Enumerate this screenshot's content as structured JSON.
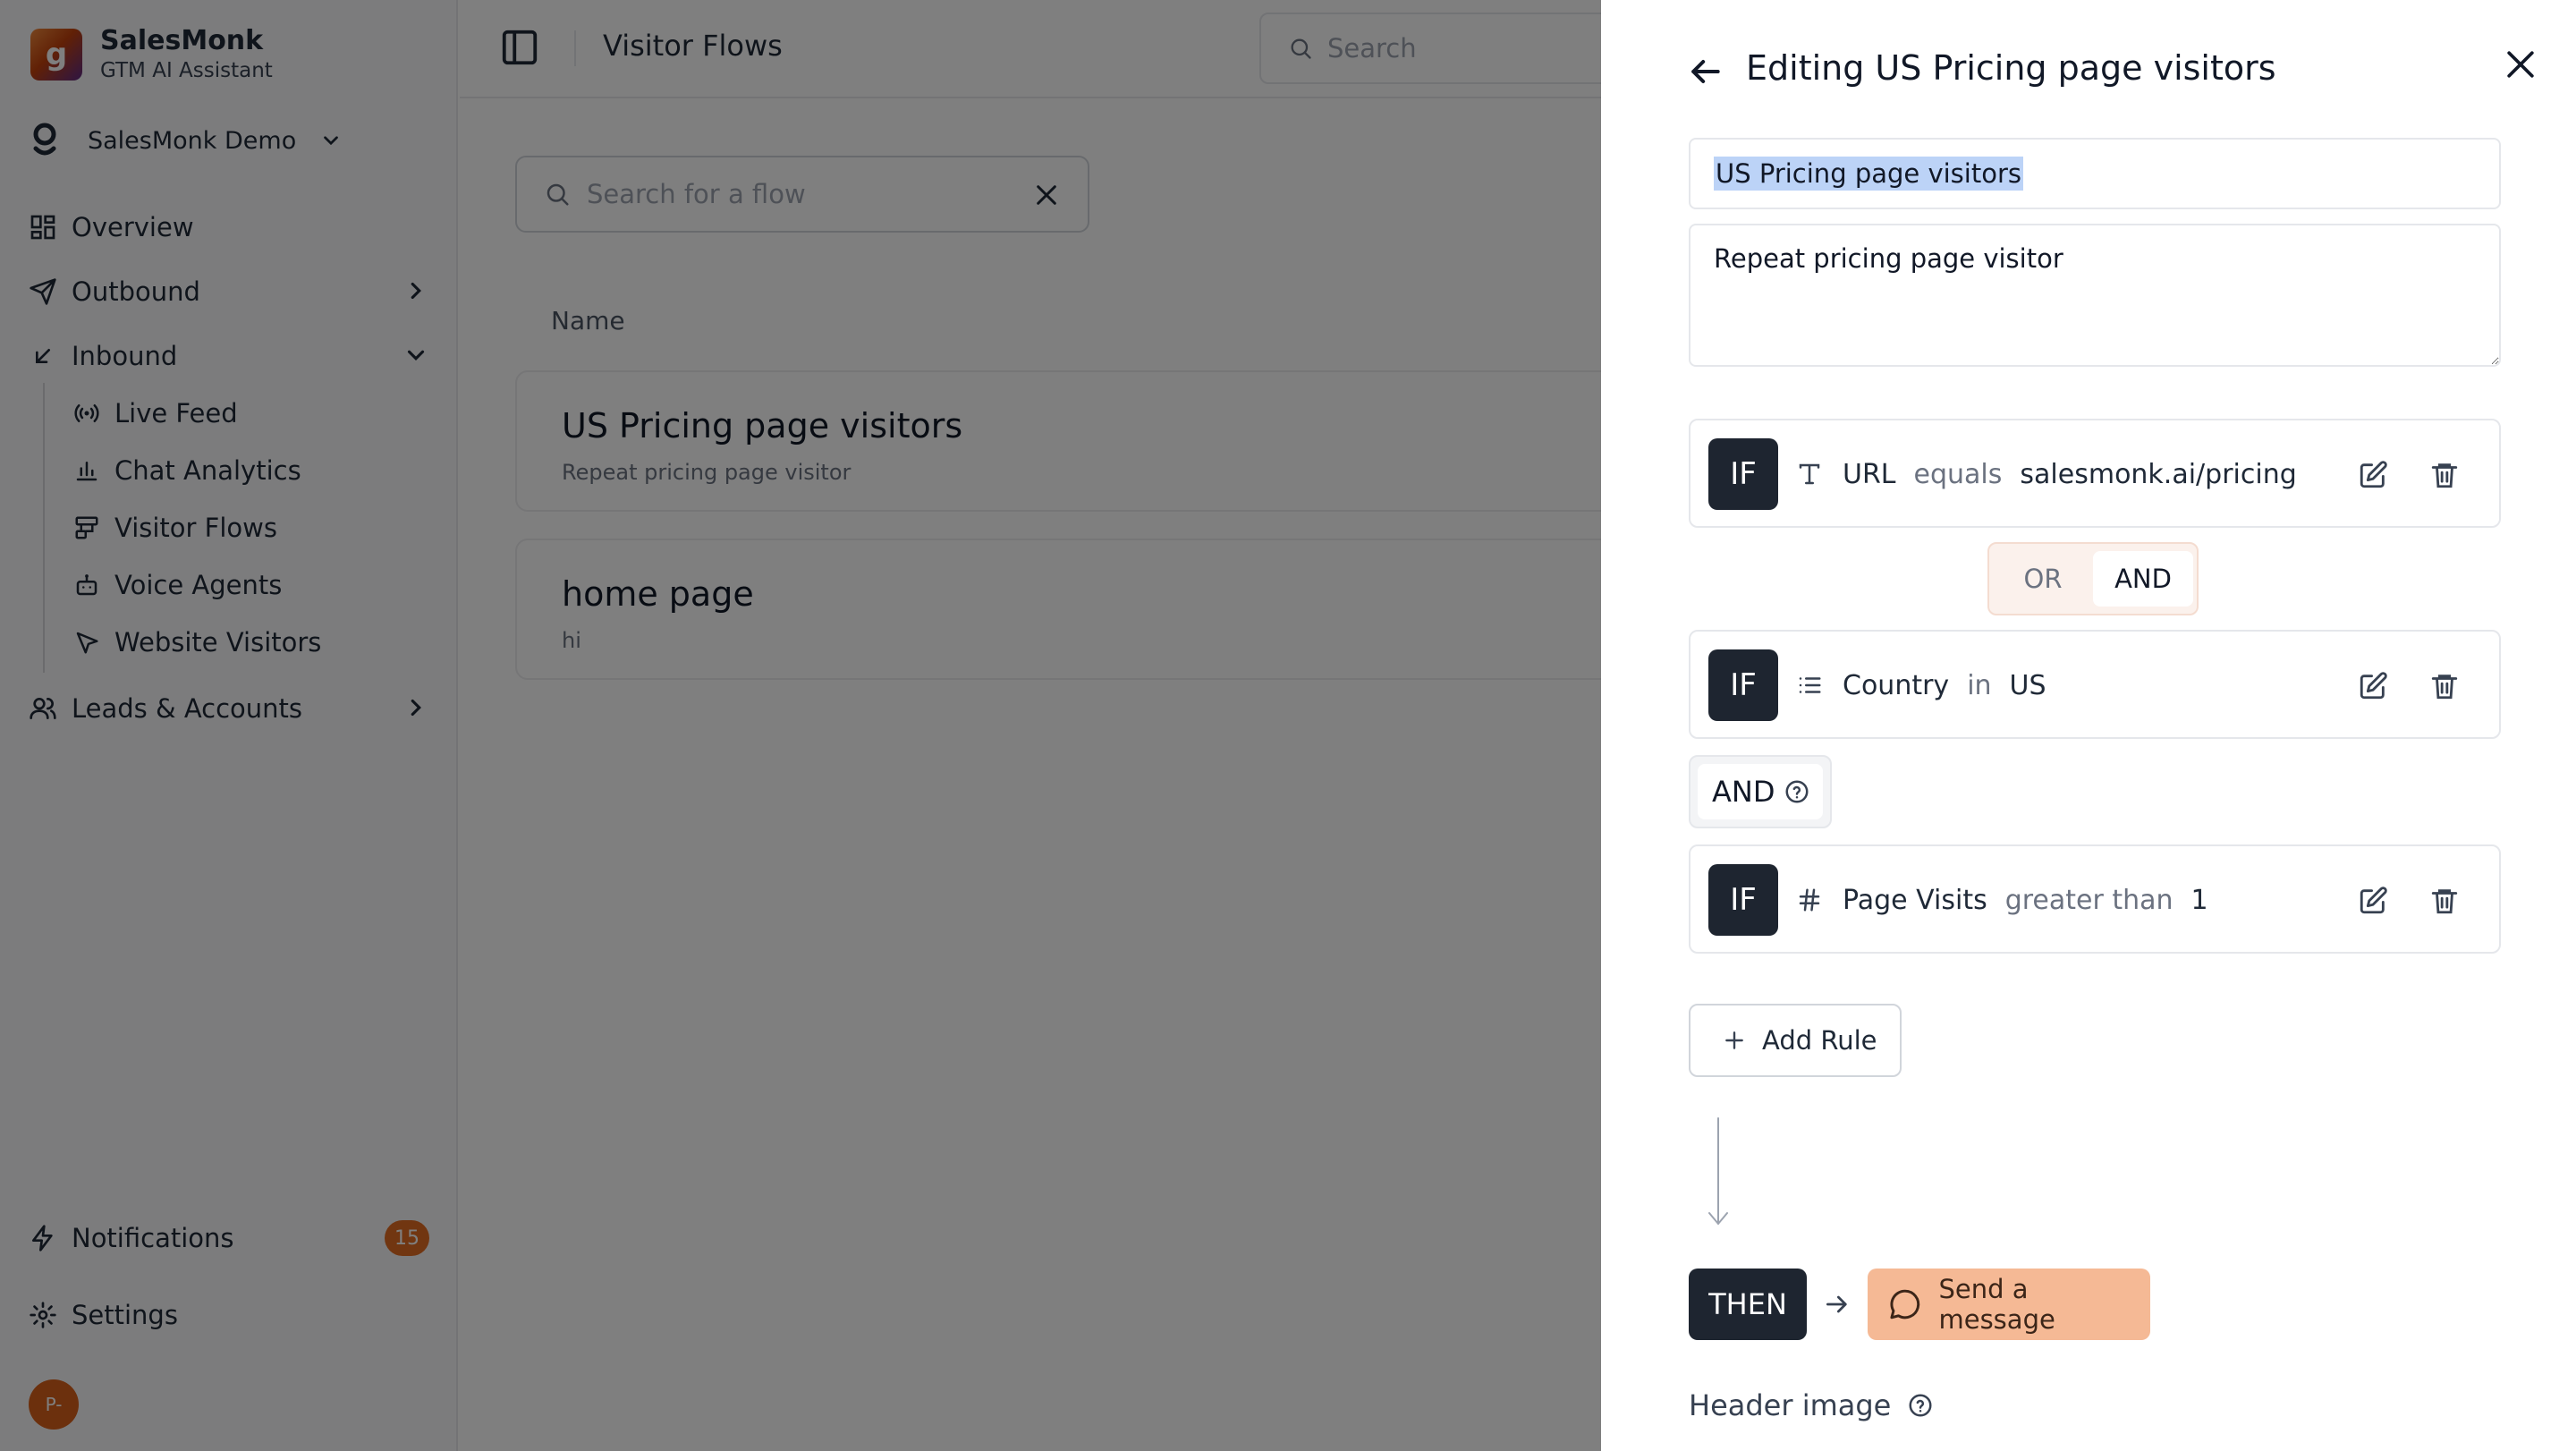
{
  "app": {
    "brand_name": "SalesMonk",
    "brand_subtitle": "GTM AI Assistant",
    "workspace": "SalesMonk Demo"
  },
  "sidebar": {
    "overview": "Overview",
    "outbound": "Outbound",
    "inbound": "Inbound",
    "inbound_items": [
      "Live Feed",
      "Chat Analytics",
      "Visitor Flows",
      "Voice Agents",
      "Website Visitors"
    ],
    "leads": "Leads & Accounts",
    "notifications": "Notifications",
    "notifications_count": "15",
    "settings": "Settings",
    "avatar_initials": "P-"
  },
  "main": {
    "page_title": "Visitor Flows",
    "search_placeholder": "Search",
    "flow_search_placeholder": "Search for a flow",
    "column_name": "Name",
    "flows": [
      {
        "title": "US Pricing page visitors",
        "subtitle": "Repeat pricing page visitor"
      },
      {
        "title": "home page",
        "subtitle": "hi"
      }
    ]
  },
  "drawer": {
    "title": "Editing US Pricing page visitors",
    "name_value": "US Pricing page visitors",
    "description_value": "Repeat pricing page visitor",
    "if_label": "IF",
    "rules": [
      {
        "icon": "text-type-icon",
        "field": "URL",
        "operator": "equals",
        "value": "salesmonk.ai/pricing"
      },
      {
        "icon": "list-icon",
        "field": "Country",
        "operator": "in",
        "value": "US"
      },
      {
        "icon": "hash-icon",
        "field": "Page Visits",
        "operator": "greater than",
        "value": "1"
      }
    ],
    "logic_toggle": {
      "or": "OR",
      "and": "AND",
      "selected": "AND"
    },
    "group_connector": "AND",
    "add_rule": "Add Rule",
    "then_label": "THEN",
    "action": "Send a message",
    "header_image": "Header image"
  },
  "colors": {
    "accent": "#f5b995",
    "dark": "#1e2530",
    "badge": "#e26c22"
  }
}
